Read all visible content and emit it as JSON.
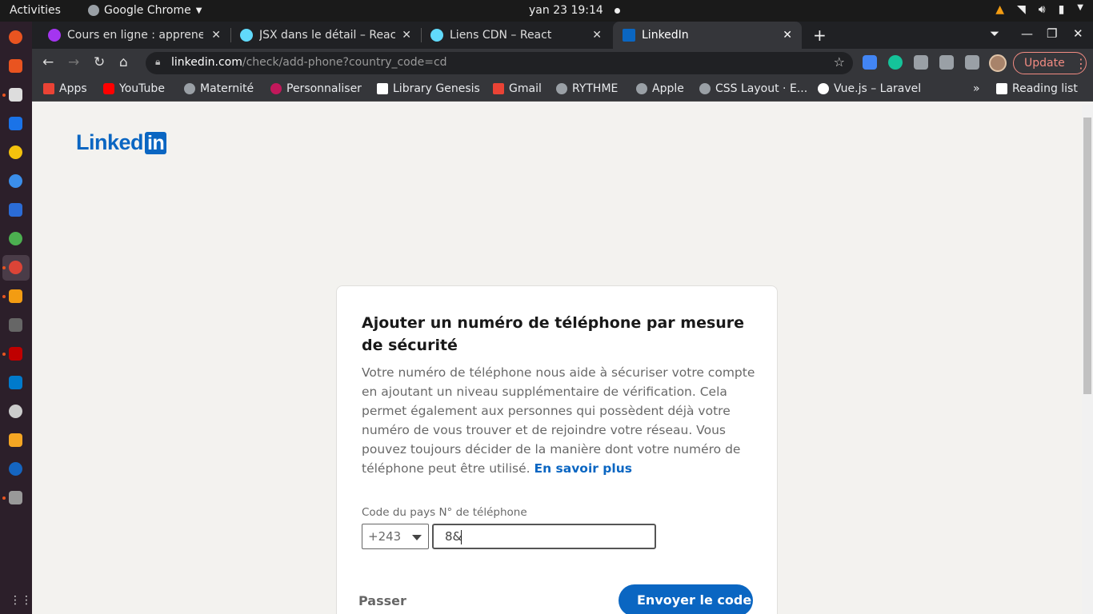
{
  "system": {
    "activities": "Activities",
    "app_name": "Google Chrome",
    "clock": "yan 23  19:14"
  },
  "tabs": [
    {
      "label": "Cours en ligne : apprenez",
      "favicon_color": "#a435f0"
    },
    {
      "label": "JSX dans le détail – React",
      "favicon_color": "#61dafb"
    },
    {
      "label": "Liens CDN – React",
      "favicon_color": "#61dafb"
    },
    {
      "label": "LinkedIn",
      "favicon_color": "#0a66c2"
    }
  ],
  "omnibox": {
    "host": "linkedin.com",
    "path": "/check/add-phone?country_code=cd"
  },
  "update_label": "Update",
  "bookmarks": [
    {
      "label": "Apps",
      "color": "#ea4335"
    },
    {
      "label": "YouTube",
      "color": "#ff0000"
    },
    {
      "label": "Maternité",
      "color": "#9aa0a6"
    },
    {
      "label": "Personnaliser",
      "color": "#c2185b"
    },
    {
      "label": "Library Genesis",
      "color": "#ffffff"
    },
    {
      "label": "Gmail",
      "color": "#ea4335"
    },
    {
      "label": "RYTHME",
      "color": "#9aa0a6"
    },
    {
      "label": "Apple",
      "color": "#9aa0a6"
    },
    {
      "label": "CSS Layout · E...",
      "color": "#9aa0a6"
    },
    {
      "label": "Vue.js – Laravel",
      "color": "#ffffff"
    },
    {
      "label": "Reading list",
      "color": "#ffffff"
    }
  ],
  "brand": {
    "logo_text": "Linked",
    "logo_in": "in",
    "accent": "#0a66c2"
  },
  "card": {
    "title": "Ajouter un numéro de téléphone par mesure de sécurité",
    "description": "Votre numéro de téléphone nous aide à sécuriser votre compte en ajoutant un niveau supplémentaire de vérification. Cela permet également aux personnes qui possèdent déjà votre numéro de vous trouver et de rejoindre votre réseau. Vous pouvez toujours décider de la manière dont votre numéro de téléphone peut être utilisé.",
    "learn_more": "En savoir plus",
    "country_label": "Code du pays",
    "phone_label": "N° de téléphone",
    "country_value": "+243",
    "phone_value": "8&",
    "skip_label": "Passer",
    "send_label": "Envoyer le code"
  }
}
